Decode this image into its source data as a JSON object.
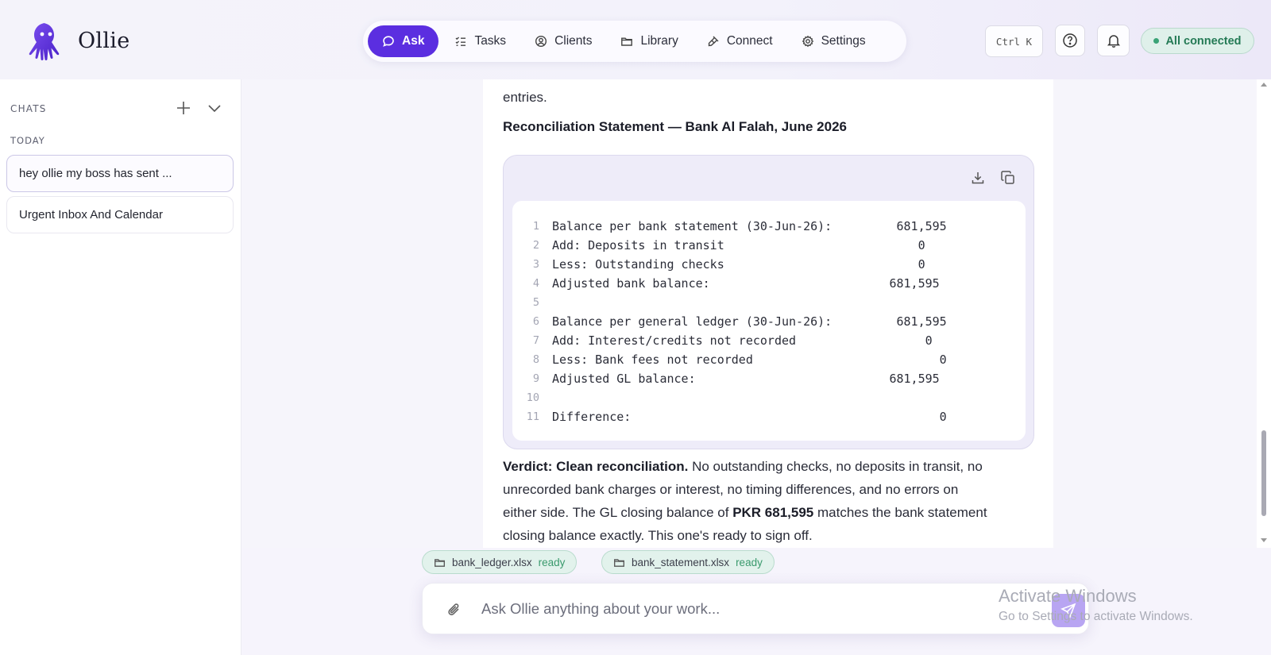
{
  "app": {
    "name": "Ollie"
  },
  "nav": {
    "items": [
      {
        "label": "Ask",
        "icon": "chat-bubble-icon",
        "active": true
      },
      {
        "label": "Tasks",
        "icon": "checklist-icon",
        "active": false
      },
      {
        "label": "Clients",
        "icon": "user-circle-icon",
        "active": false
      },
      {
        "label": "Library",
        "icon": "folder-icon",
        "active": false
      },
      {
        "label": "Connect",
        "icon": "plug-icon",
        "active": false
      },
      {
        "label": "Settings",
        "icon": "gear-icon",
        "active": false
      }
    ]
  },
  "header": {
    "shortcut": "Ctrl K",
    "status": "All connected",
    "status_color": "#247a55"
  },
  "sidebar": {
    "chats_label": "CHATS",
    "today_label": "TODAY",
    "items": [
      {
        "label": "hey ollie my boss has sent ...",
        "active": true
      },
      {
        "label": "Urgent Inbox And Calendar",
        "active": false
      }
    ]
  },
  "message": {
    "partial_top": "entries.",
    "heading": "Reconciliation Statement — Bank Al Falah, June 2026",
    "code_lines": [
      {
        "n": "1",
        "text": "Balance per bank statement (30-Jun-26):         681,595"
      },
      {
        "n": "2",
        "text": "Add: Deposits in transit                           0"
      },
      {
        "n": "3",
        "text": "Less: Outstanding checks                           0"
      },
      {
        "n": "4",
        "text": "Adjusted bank balance:                         681,595"
      },
      {
        "n": "5",
        "text": ""
      },
      {
        "n": "6",
        "text": "Balance per general ledger (30-Jun-26):         681,595"
      },
      {
        "n": "7",
        "text": "Add: Interest/credits not recorded                  0"
      },
      {
        "n": "8",
        "text": "Less: Bank fees not recorded                          0"
      },
      {
        "n": "9",
        "text": "Adjusted GL balance:                           681,595"
      },
      {
        "n": "10",
        "text": ""
      },
      {
        "n": "11",
        "text": "Difference:                                           0"
      }
    ],
    "verdict_bold": "Verdict: Clean reconciliation.",
    "verdict_rest": " No outstanding checks, no deposits in transit, no",
    "line2": "unrecorded bank charges or interest, no timing differences, and no errors on",
    "line3_a": "either side. The GL closing balance of ",
    "line3_bold": "PKR 681,595",
    "line3_b": " matches the bank statement",
    "line4": "closing balance exactly. This one's ready to sign off."
  },
  "attachments": [
    {
      "name": "bank_ledger.xlsx",
      "status": "ready"
    },
    {
      "name": "bank_statement.xlsx",
      "status": "ready"
    }
  ],
  "composer": {
    "placeholder": "Ask Ollie anything about your work..."
  },
  "watermark": {
    "line1": "Activate Windows",
    "line2": "Go to Settings to activate Windows."
  },
  "colors": {
    "accent": "#5b2ee0",
    "send": "#b8a5f2"
  }
}
